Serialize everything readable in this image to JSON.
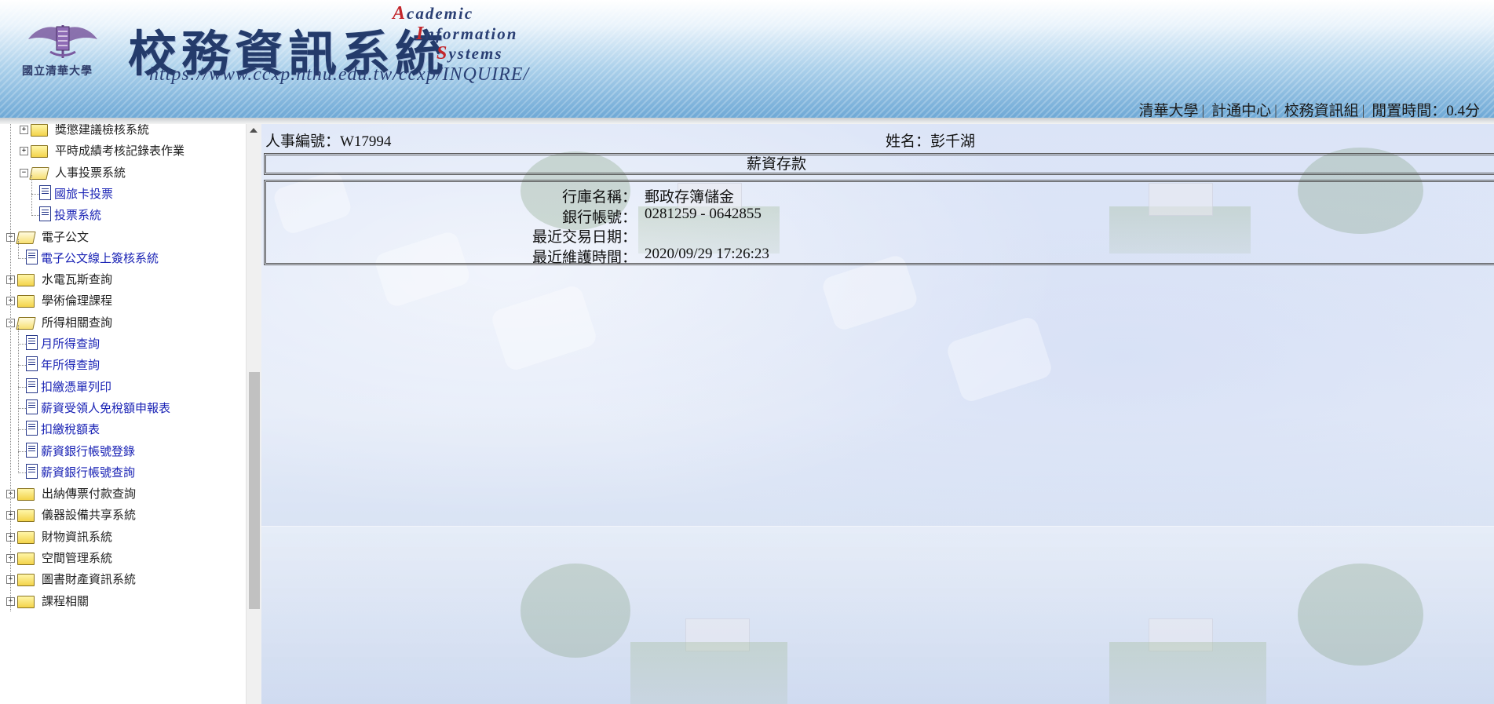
{
  "header": {
    "school_name": "國立清華大學",
    "system_title": "校務資訊系統",
    "english_title": [
      {
        "cap": "A",
        "rest": "cademic"
      },
      {
        "cap": "I",
        "rest": "nformation"
      },
      {
        "cap": "S",
        "rest": "ystems"
      }
    ],
    "url": "https://www.ccxp.nthu.edu.tw/ccxp/INQUIRE/",
    "top_links": [
      "清華大學",
      "計通中心",
      "校務資訊組"
    ],
    "idle_time": "閒置時間：0.4分",
    "colors": {
      "banner_top": "#ffffff",
      "banner_bottom": "#6fa9d6",
      "title": "#243b6b",
      "accent_red": "#c3262b"
    }
  },
  "sidebar": {
    "items": [
      {
        "label": "獎懲建議檢核系統",
        "type": "folder",
        "level": 1,
        "expand": "plus"
      },
      {
        "label": "平時成績考核記錄表作業",
        "type": "folder",
        "level": 1,
        "expand": "plus"
      },
      {
        "label": "人事投票系統",
        "type": "folder-open",
        "level": 1,
        "expand": "minus"
      },
      {
        "label": "國旅卡投票",
        "type": "page",
        "level": 2
      },
      {
        "label": "投票系統",
        "type": "page",
        "level": 2
      },
      {
        "label": "電子公文",
        "type": "folder-open",
        "level": 0,
        "expand": "minus"
      },
      {
        "label": "電子公文線上簽核系統",
        "type": "page",
        "level": 1
      },
      {
        "label": "水電瓦斯查詢",
        "type": "folder",
        "level": 0,
        "expand": "plus"
      },
      {
        "label": "學術倫理課程",
        "type": "folder",
        "level": 0,
        "expand": "plus"
      },
      {
        "label": "所得相關查詢",
        "type": "folder-open",
        "level": 0,
        "expand": "minus"
      },
      {
        "label": "月所得查詢",
        "type": "page",
        "level": 1
      },
      {
        "label": "年所得查詢",
        "type": "page",
        "level": 1
      },
      {
        "label": "扣繳憑單列印",
        "type": "page",
        "level": 1
      },
      {
        "label": "薪資受領人免稅額申報表",
        "type": "page",
        "level": 1
      },
      {
        "label": "扣繳稅額表",
        "type": "page",
        "level": 1
      },
      {
        "label": "薪資銀行帳號登錄",
        "type": "page",
        "level": 1
      },
      {
        "label": "薪資銀行帳號查詢",
        "type": "page",
        "level": 1
      },
      {
        "label": "出納傳票付款查詢",
        "type": "folder",
        "level": 0,
        "expand": "plus"
      },
      {
        "label": "儀器設備共享系統",
        "type": "folder",
        "level": 0,
        "expand": "plus"
      },
      {
        "label": "財物資訊系統",
        "type": "folder",
        "level": 0,
        "expand": "plus"
      },
      {
        "label": "空間管理系統",
        "type": "folder",
        "level": 0,
        "expand": "plus"
      },
      {
        "label": "圖書財產資訊系統",
        "type": "folder",
        "level": 0,
        "expand": "plus"
      },
      {
        "label": "課程相關",
        "type": "folder",
        "level": 0,
        "expand": "plus"
      }
    ]
  },
  "main": {
    "staff_id": "人事編號：W17994",
    "staff_name": "姓名：彭千湖",
    "section_title": "薪資存款",
    "details": [
      {
        "key": "行庫名稱：",
        "value": "郵政存簿儲金"
      },
      {
        "key": "銀行帳號：",
        "value": "0281259 - 0642855"
      },
      {
        "key": "最近交易日期：",
        "value": ""
      },
      {
        "key": "最近維護時間：",
        "value": "2020/09/29 17:26:23"
      }
    ]
  }
}
